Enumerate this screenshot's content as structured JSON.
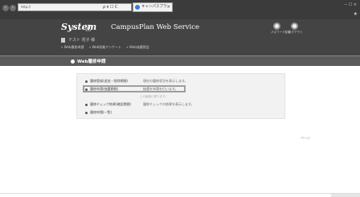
{
  "browser": {
    "url": "http://",
    "address_tools": "ρ ▾ ☐ C",
    "tab_title": "キャンパスプラン",
    "tab_close": "×",
    "window_controls": "− ☐ ×",
    "window_icons": "★"
  },
  "header": {
    "logo": "System",
    "logo_arrows": "〉〉〉",
    "service_name": "CampusPlan Web Service",
    "icons": [
      {
        "name": "user-settings-icon",
        "label": "パスワード変更"
      },
      {
        "name": "logout-icon",
        "label": "ログアウト"
      }
    ],
    "user_name": "テスト 花子 様",
    "menu_links": [
      "» Web履修申請",
      "» Web授業アンケート",
      "» Web成績照会"
    ]
  },
  "section": {
    "title": "Web履修申請"
  },
  "menu": {
    "items": [
      {
        "label": "履修登録(追加・削除期間)",
        "desc": "現在の履修状況を表示します。"
      },
      {
        "label": "履修申請(抽選期間)",
        "desc": "抽選を申請を行います。"
      },
      {
        "label": "履修チェック結果(確認期間)",
        "desc": "履修チェックの結果を表示します。"
      },
      {
        "label": "履修申請(一覧)",
        "desc": ""
      }
    ],
    "note": "上の画面に移ります。"
  },
  "page_top": "ページ"
}
